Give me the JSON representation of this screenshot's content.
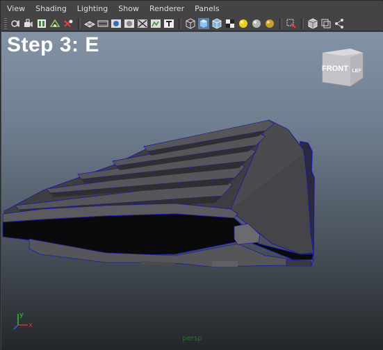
{
  "menu": {
    "items": [
      "View",
      "Shading",
      "Lighting",
      "Show",
      "Renderer",
      "Panels"
    ]
  },
  "toolbar": {
    "groups": [
      [
        "select-camera-icon",
        "lock-camera-icon",
        "camera-attributes-icon",
        "bookmarks-icon",
        "image-plane-icon"
      ],
      [
        "grid-icon",
        "film-gate-icon",
        "resolution-gate-icon",
        "gate-mask-icon",
        "field-chart-icon",
        "safe-action-icon",
        "safe-title-icon"
      ],
      [
        "wireframe-icon",
        "smooth-shade-icon",
        "smooth-wireframe-icon",
        "textured-icon",
        "default-light-icon",
        "all-lights-icon",
        "shadows-icon"
      ],
      [
        "isolate-select-icon"
      ],
      [
        "xray-icon",
        "xray-joints-icon",
        "xray-components-icon"
      ]
    ],
    "active": [
      "smooth-shade-icon"
    ]
  },
  "viewport": {
    "overlay_text": "Step 3: E",
    "camera_name": "persp",
    "viewcube": {
      "front_label": "FRONT",
      "side_label": "LEF"
    },
    "axis": {
      "x_label": "x",
      "y_label": "y"
    },
    "colors": {
      "gradient_top": "#8393a5",
      "gradient_bottom": "#242729",
      "model_fill": "#3d3d42",
      "model_selected_edge": "#1a1aa6",
      "camera_name_color": "#1e7a1e"
    }
  }
}
